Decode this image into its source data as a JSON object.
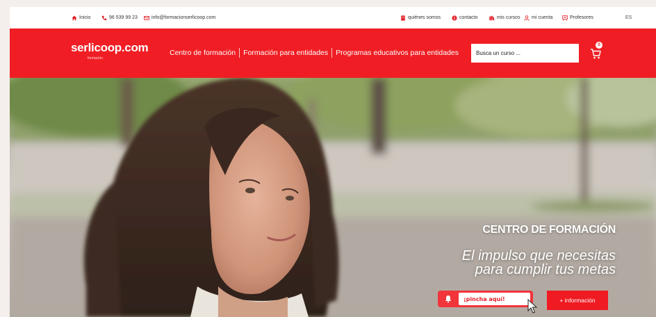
{
  "topbar": {
    "inicio": "Inicio",
    "phone": "96 539 99 23",
    "email": "info@formacionserlicoop.com",
    "quienes": "quiénes somos",
    "contacto": "contacto",
    "mis_cursos": "mis cursos",
    "mi_cuenta": "mi cuenta",
    "profesores": "Profesores",
    "lang": "ES"
  },
  "navbar": {
    "logo": "serlicoop.com",
    "logo_sub": "formación",
    "links": [
      "Centro de formación",
      "Formación para entidades",
      "Programas educativos para entidades"
    ],
    "search_placeholder": "Busca un curso ...",
    "cart_count": "0"
  },
  "hero": {
    "title": "CENTRO DE FORMACIÓN",
    "subtitle_line1": "El impulso que necesitas",
    "subtitle_line2": "para cumplir tus metas",
    "pincha_label": "¡pincha aquí!",
    "info_label": "+ información"
  },
  "colors": {
    "brand_red": "#f01e24",
    "white": "#ffffff"
  },
  "icons": [
    "home-icon",
    "phone-icon",
    "email-icon",
    "building-icon",
    "info-icon",
    "books-icon",
    "user-icon",
    "teacher-icon",
    "cart-icon",
    "bell-icon",
    "cursor-icon"
  ]
}
